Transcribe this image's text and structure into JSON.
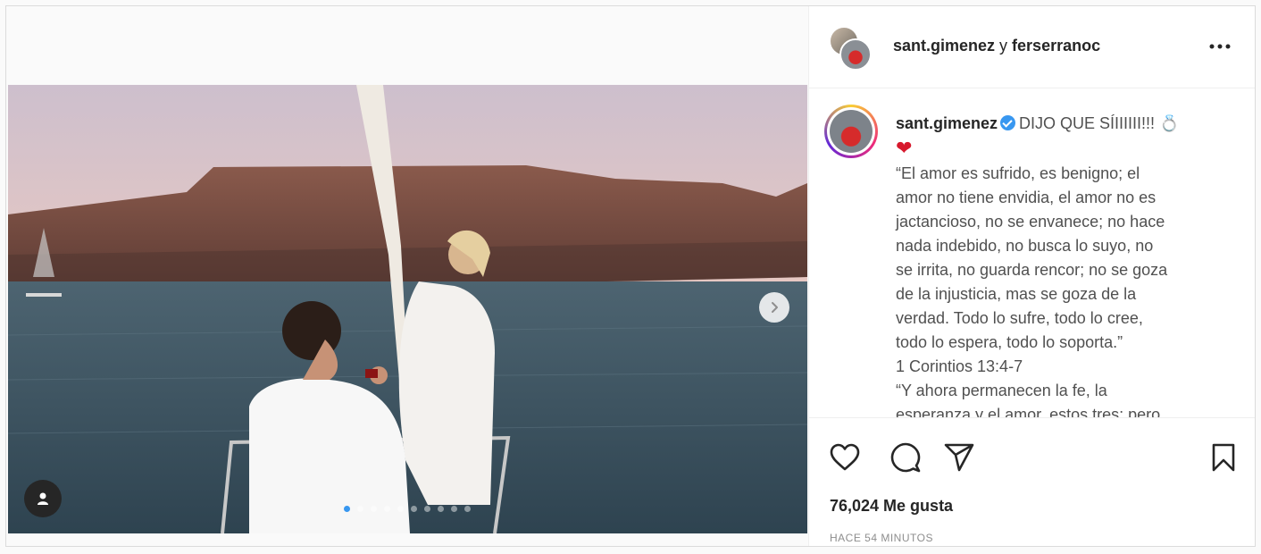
{
  "post": {
    "header": {
      "user1": "sant.gimenez",
      "separator": " y ",
      "user2": "ferserranoc",
      "more_icon": "more-horizontal-icon"
    },
    "caption": {
      "username": "sant.gimenez",
      "verified": true,
      "headline": "DIJO QUE SÍIIIIII!!!",
      "ring_emoji": "💍",
      "heart_emoji": "❤",
      "lines": [
        "“El amor es sufrido, es benigno; el",
        "amor no tiene envidia, el amor no es",
        "jactancioso, no se envanece; no hace",
        "nada indebido, no busca lo suyo, no",
        "se irrita, no guarda rencor; no se goza",
        "de la injusticia, mas se goza de la",
        "verdad. Todo lo sufre, todo lo cree,",
        "todo lo espera, todo lo soporta.”",
        "1 Corintios 13:4-7",
        "“Y ahora permanecen la fe, la",
        "esperanza y el amor, estos tres; pero"
      ]
    },
    "actions": {
      "like_icon": "heart-icon",
      "comment_icon": "comment-icon",
      "share_icon": "send-icon",
      "save_icon": "bookmark-icon"
    },
    "likes": "76,024 Me gusta",
    "timestamp": "HACE 54 MINUTOS",
    "carousel": {
      "total": 10,
      "current": 1,
      "next_icon": "chevron-right-icon",
      "tag_icon": "user-tag-icon"
    },
    "colors": {
      "accent": "#3897f0",
      "text": "#262626",
      "muted": "#8e8e8e"
    }
  }
}
